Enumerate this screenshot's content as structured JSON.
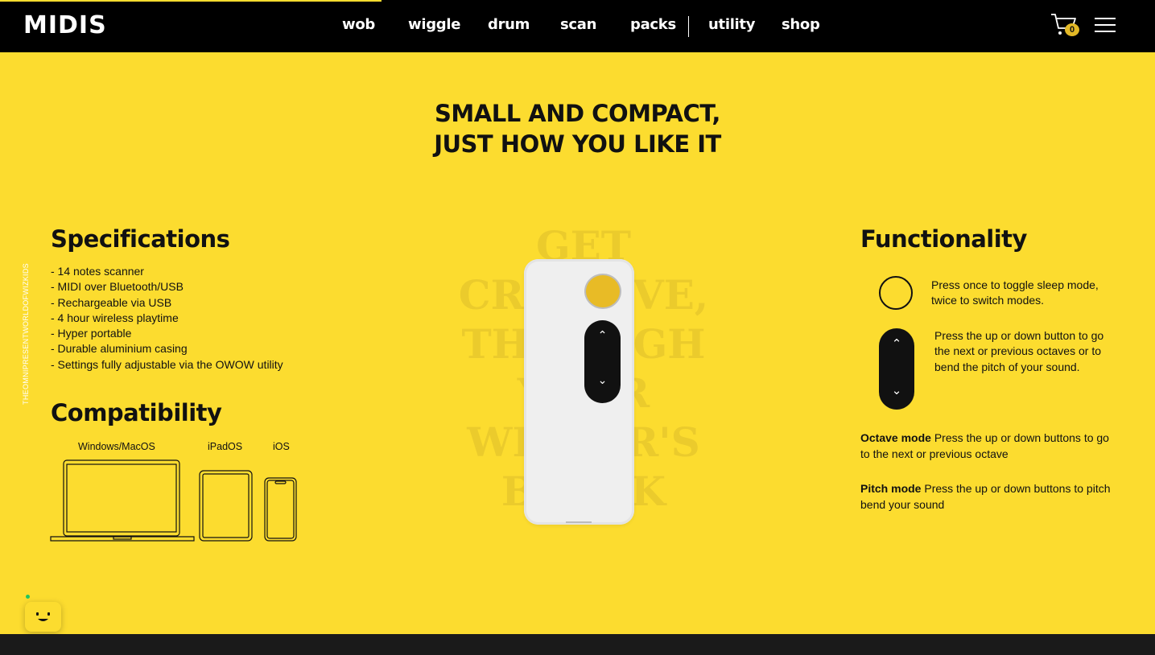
{
  "brand": {
    "logo": "MIDIS"
  },
  "nav": {
    "items": [
      {
        "label": "wob"
      },
      {
        "label": "wiggle"
      },
      {
        "label": "drum"
      },
      {
        "label": "scan"
      },
      {
        "label": "packs"
      },
      {
        "label": "utility"
      },
      {
        "label": "shop"
      }
    ],
    "cart_count": "0"
  },
  "side_text": "THEOMNIPRESENTWORLDOFWIZKIDS",
  "hero": {
    "line1": "SMALL AND COMPACT,",
    "line2": "JUST HOW YOU LIKE IT"
  },
  "background_words": [
    "GET",
    "CREATIVE,",
    "THROUGH",
    "YOUR",
    "WRITER'S",
    "BLOCK"
  ],
  "specifications": {
    "title": "Specifications",
    "items": [
      "- 14 notes scanner",
      "- MIDI over Bluetooth/USB",
      "- Rechargeable via USB",
      "- 4 hour wireless playtime",
      "- Hyper portable",
      "- Durable aluminium casing",
      "- Settings fully adjustable via the OWOW utility"
    ]
  },
  "compatibility": {
    "title": "Compatibility",
    "labels": [
      "Windows/MacOS",
      "iPadOS",
      "iOS"
    ]
  },
  "functionality": {
    "title": "Functionality",
    "power_text": "Press once to toggle sleep mode, twice to switch modes.",
    "arrows_text": "Press the up or down button to go the next or previous octaves or to bend the pitch of your sound.",
    "octave_label": "Octave mode",
    "octave_text": " Press the up or down buttons to go to the next or previous octave",
    "pitch_label": "Pitch mode",
    "pitch_text": " Press the up or down buttons to pitch bend your sound"
  },
  "colors": {
    "accent": "#fcdc2f",
    "nav_bg": "#000000",
    "device_button": "#e8bb26"
  },
  "icons": [
    "cart-icon",
    "hamburger-menu-icon",
    "power-button-icon",
    "up-down-buttons-icon",
    "chat-bot-icon"
  ]
}
